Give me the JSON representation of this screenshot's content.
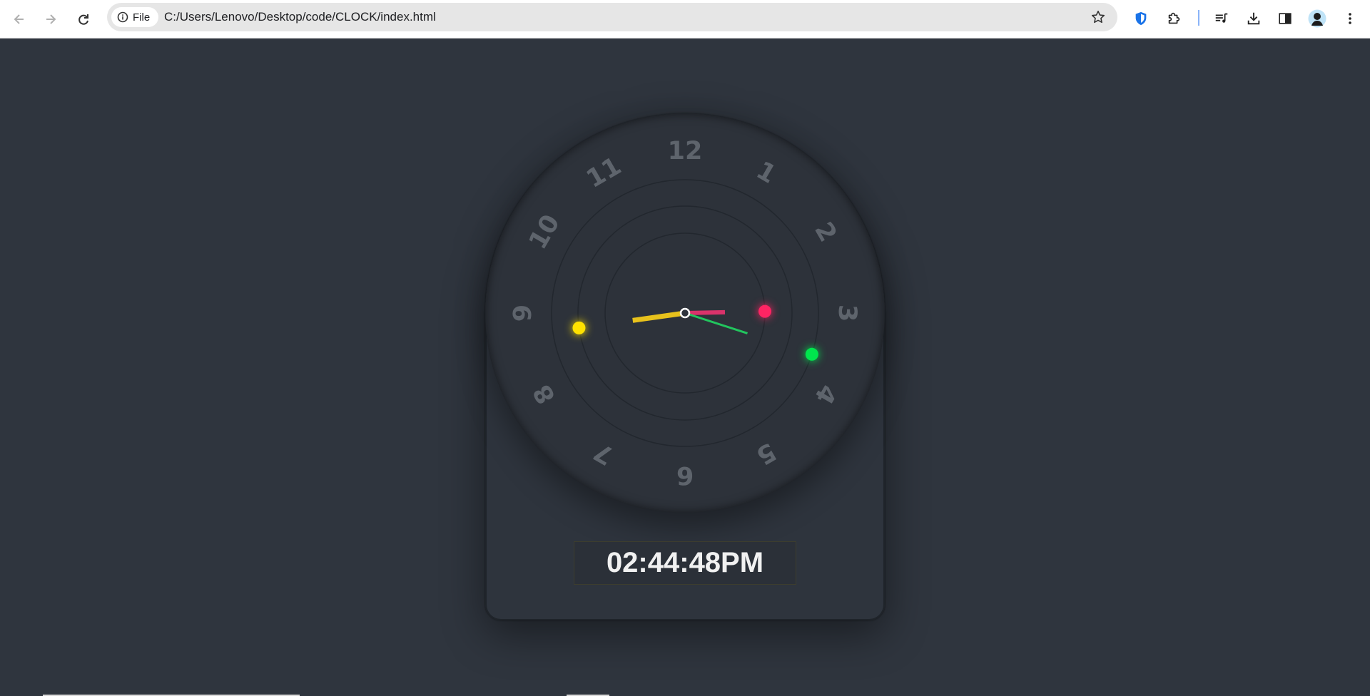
{
  "browser": {
    "file_label": "File",
    "url": "C:/Users/Lenovo/Desktop/code/CLOCK/index.html"
  },
  "icons": {
    "back": "arrow-left",
    "forward": "arrow-right",
    "reload": "reload",
    "info": "info-circle",
    "bookmark": "star",
    "shield": "shield",
    "extensions": "puzzle",
    "media": "queue-music",
    "downloads": "download",
    "side_panel": "side-panel",
    "profile": "avatar",
    "menu": "three-dots"
  },
  "clock": {
    "numbers": [
      "12",
      "1",
      "2",
      "3",
      "4",
      "5",
      "6",
      "7",
      "8",
      "9",
      "10",
      "11"
    ],
    "time": {
      "hours": 2,
      "minutes": 44,
      "seconds": 48
    },
    "digital_time": "02:44:48PM",
    "colors": {
      "hour_hand": "#e8c21c",
      "minute_hand": "#d9336b",
      "second_hand": "#22c55e",
      "hour_dot": "#ffe100",
      "minute_dot": "#ff2463",
      "second_dot": "#00e64d",
      "numerals": "#5e646c",
      "background": "#2f353e"
    }
  }
}
